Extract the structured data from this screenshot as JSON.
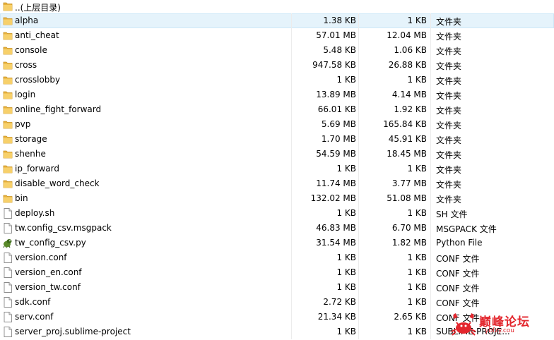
{
  "up_entry": {
    "label": "..(上层目录)",
    "icon": "folder-icon"
  },
  "files": [
    {
      "name": "alpha",
      "size": "1.38 KB",
      "csize": "1 KB",
      "type": "文件夹",
      "icon": "folder",
      "selected": true
    },
    {
      "name": "anti_cheat",
      "size": "57.01 MB",
      "csize": "12.04 MB",
      "type": "文件夹",
      "icon": "folder"
    },
    {
      "name": "console",
      "size": "5.48 KB",
      "csize": "1.06 KB",
      "type": "文件夹",
      "icon": "folder"
    },
    {
      "name": "cross",
      "size": "947.58 KB",
      "csize": "26.88 KB",
      "type": "文件夹",
      "icon": "folder"
    },
    {
      "name": "crosslobby",
      "size": "1 KB",
      "csize": "1 KB",
      "type": "文件夹",
      "icon": "folder"
    },
    {
      "name": "login",
      "size": "13.89 MB",
      "csize": "4.14 MB",
      "type": "文件夹",
      "icon": "folder"
    },
    {
      "name": "online_fight_forward",
      "size": "66.01 KB",
      "csize": "1.92 KB",
      "type": "文件夹",
      "icon": "folder"
    },
    {
      "name": "pvp",
      "size": "5.69 MB",
      "csize": "165.84 KB",
      "type": "文件夹",
      "icon": "folder"
    },
    {
      "name": "storage",
      "size": "1.70 MB",
      "csize": "45.91 KB",
      "type": "文件夹",
      "icon": "folder"
    },
    {
      "name": "shenhe",
      "size": "54.59 MB",
      "csize": "18.45 MB",
      "type": "文件夹",
      "icon": "folder"
    },
    {
      "name": "ip_forward",
      "size": "1 KB",
      "csize": "1 KB",
      "type": "文件夹",
      "icon": "folder"
    },
    {
      "name": "disable_word_check",
      "size": "11.74 MB",
      "csize": "3.77 MB",
      "type": "文件夹",
      "icon": "folder"
    },
    {
      "name": "bin",
      "size": "132.02 MB",
      "csize": "51.08 MB",
      "type": "文件夹",
      "icon": "folder"
    },
    {
      "name": "deploy.sh",
      "size": "1 KB",
      "csize": "1 KB",
      "type": "SH 文件",
      "icon": "file"
    },
    {
      "name": "tw.config_csv.msgpack",
      "size": "46.83 MB",
      "csize": "6.70 MB",
      "type": "MSGPACK 文件",
      "icon": "file"
    },
    {
      "name": "tw_config_csv.py",
      "size": "31.54 MB",
      "csize": "1.82 MB",
      "type": "Python File",
      "icon": "python"
    },
    {
      "name": "version.conf",
      "size": "1 KB",
      "csize": "1 KB",
      "type": "CONF 文件",
      "icon": "file"
    },
    {
      "name": "version_en.conf",
      "size": "1 KB",
      "csize": "1 KB",
      "type": "CONF 文件",
      "icon": "file"
    },
    {
      "name": "version_tw.conf",
      "size": "1 KB",
      "csize": "1 KB",
      "type": "CONF 文件",
      "icon": "file"
    },
    {
      "name": "sdk.conf",
      "size": "2.72 KB",
      "csize": "1 KB",
      "type": "CONF 文件",
      "icon": "file"
    },
    {
      "name": "serv.conf",
      "size": "21.34 KB",
      "csize": "2.65 KB",
      "type": "CONF 文件",
      "icon": "file"
    },
    {
      "name": "server_proj.sublime-project",
      "size": "1 KB",
      "csize": "1 KB",
      "type": "SUBLIME-PROJE...",
      "icon": "file"
    }
  ],
  "watermark": {
    "title": "巅峰论坛",
    "subtitle": "ybfzy.cou",
    "color": "#e3262d"
  },
  "colors": {
    "folder": "#f3c04f",
    "selection": "#e5f3fb"
  }
}
